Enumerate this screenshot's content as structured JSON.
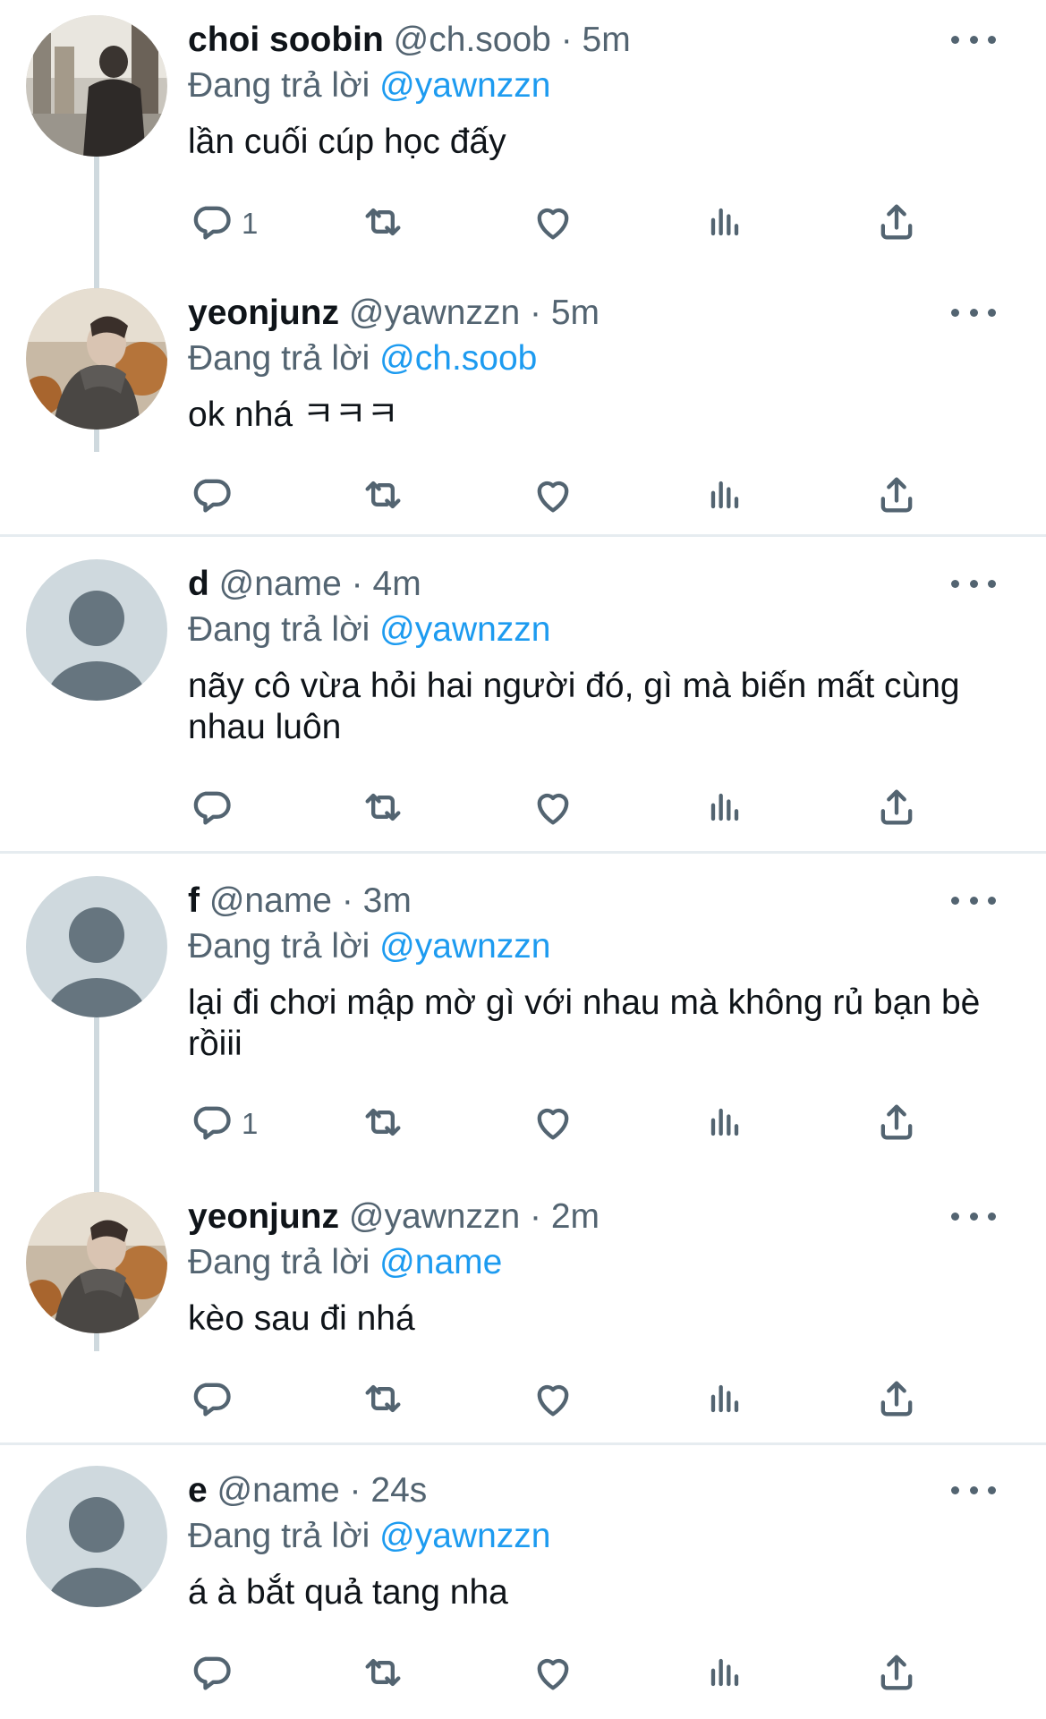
{
  "colors": {
    "text": "#0f1419",
    "secondary": "#536471",
    "link": "#1d9bf0",
    "divider": "#e6ecf0",
    "thread_line": "#cfd9de"
  },
  "reply_prefix": "Đang trả lời",
  "tweets": [
    {
      "name": "choi soobin",
      "handle": "@ch.soob",
      "time": "5m",
      "reply_to": "@yawnzzn",
      "text": "lần cuối cúp học đấy",
      "reply_count": "1",
      "avatar": "photo-street"
    },
    {
      "name": "yeonjunz",
      "handle": "@yawnzzn",
      "time": "5m",
      "reply_to": "@ch.soob",
      "text": "ok nhá ㅋㅋㅋ",
      "reply_count": "",
      "avatar": "photo-autumn"
    },
    {
      "name": "d",
      "handle": "@name",
      "time": "4m",
      "reply_to": "@yawnzzn",
      "text": "nãy cô vừa hỏi hai người đó, gì mà biến mất cùng nhau luôn",
      "reply_count": "",
      "avatar": "default-person"
    },
    {
      "name": "f",
      "handle": "@name",
      "time": "3m",
      "reply_to": "@yawnzzn",
      "text": "lại đi chơi mập mờ gì với nhau mà không rủ bạn bè rồiii",
      "reply_count": "1",
      "avatar": "default-person"
    },
    {
      "name": "yeonjunz",
      "handle": "@yawnzzn",
      "time": "2m",
      "reply_to": "@name",
      "text": "kèo sau đi nhá",
      "reply_count": "",
      "avatar": "photo-autumn"
    },
    {
      "name": "e",
      "handle": "@name",
      "time": "24s",
      "reply_to": "@yawnzzn",
      "text": "á à bắt quả tang nha",
      "reply_count": "",
      "avatar": "default-person"
    }
  ],
  "icons": {
    "more": "more-dots-icon",
    "reply": "reply-bubble-icon",
    "retweet": "retweet-icon",
    "like": "heart-icon",
    "stats": "bar-stats-icon",
    "share": "share-upload-icon"
  }
}
